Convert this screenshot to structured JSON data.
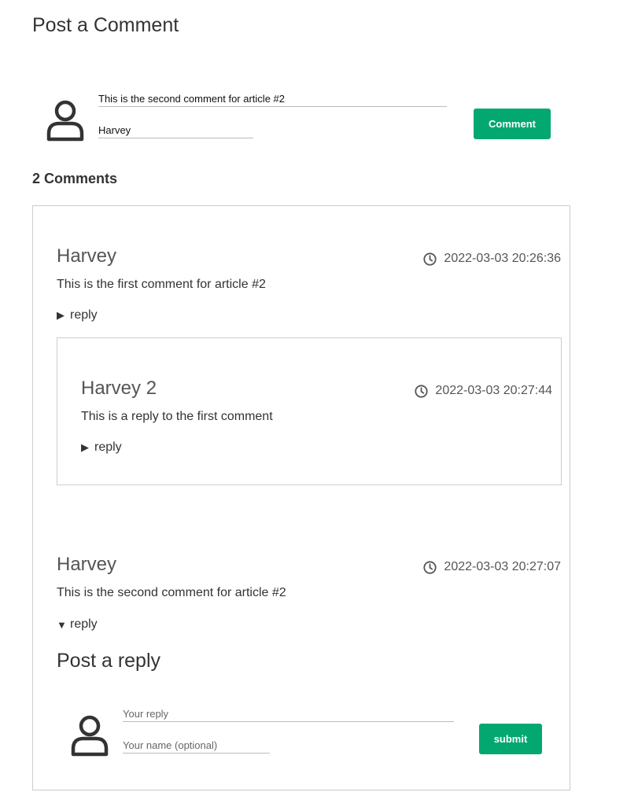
{
  "post_form": {
    "title": "Post a Comment",
    "comment_value": "This is the second comment for article #2",
    "name_value": "Harvey",
    "button_label": "Comment"
  },
  "comments_heading": "2 Comments",
  "comments": [
    {
      "author": "Harvey",
      "timestamp": "2022-03-03 20:26:36",
      "text": "This is the first comment for article #2",
      "reply_label": "reply",
      "replies": [
        {
          "author": "Harvey 2",
          "timestamp": "2022-03-03 20:27:44",
          "text": "This is a reply to the first comment",
          "reply_label": "reply"
        }
      ]
    },
    {
      "author": "Harvey",
      "timestamp": "2022-03-03 20:27:07",
      "text": "This is the second comment for article #2",
      "reply_label": "reply"
    }
  ],
  "reply_form": {
    "title": "Post a reply",
    "reply_placeholder": "Your reply",
    "name_placeholder": "Your name (optional)",
    "button_label": "submit"
  },
  "icons": {
    "user": "user-icon",
    "clock": "clock-icon",
    "collapsed": "triangle-right-icon",
    "expanded": "triangle-down-icon"
  },
  "colors": {
    "accent": "#02a870",
    "border": "#cccccc",
    "text": "#333333",
    "muted": "#555555"
  }
}
